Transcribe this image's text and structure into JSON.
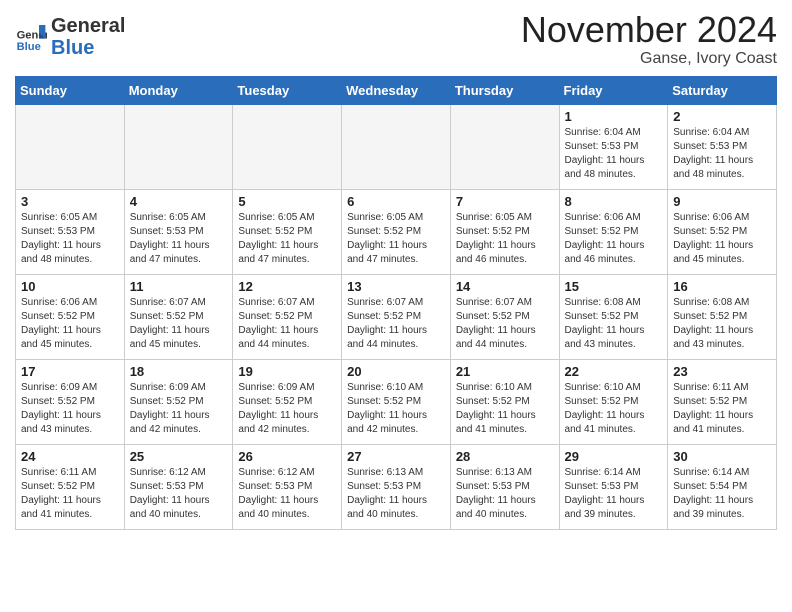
{
  "header": {
    "logo_line1": "General",
    "logo_line2": "Blue",
    "month": "November 2024",
    "location": "Ganse, Ivory Coast"
  },
  "days_of_week": [
    "Sunday",
    "Monday",
    "Tuesday",
    "Wednesday",
    "Thursday",
    "Friday",
    "Saturday"
  ],
  "weeks": [
    [
      {
        "day": "",
        "info": ""
      },
      {
        "day": "",
        "info": ""
      },
      {
        "day": "",
        "info": ""
      },
      {
        "day": "",
        "info": ""
      },
      {
        "day": "",
        "info": ""
      },
      {
        "day": "1",
        "info": "Sunrise: 6:04 AM\nSunset: 5:53 PM\nDaylight: 11 hours\nand 48 minutes."
      },
      {
        "day": "2",
        "info": "Sunrise: 6:04 AM\nSunset: 5:53 PM\nDaylight: 11 hours\nand 48 minutes."
      }
    ],
    [
      {
        "day": "3",
        "info": "Sunrise: 6:05 AM\nSunset: 5:53 PM\nDaylight: 11 hours\nand 48 minutes."
      },
      {
        "day": "4",
        "info": "Sunrise: 6:05 AM\nSunset: 5:53 PM\nDaylight: 11 hours\nand 47 minutes."
      },
      {
        "day": "5",
        "info": "Sunrise: 6:05 AM\nSunset: 5:52 PM\nDaylight: 11 hours\nand 47 minutes."
      },
      {
        "day": "6",
        "info": "Sunrise: 6:05 AM\nSunset: 5:52 PM\nDaylight: 11 hours\nand 47 minutes."
      },
      {
        "day": "7",
        "info": "Sunrise: 6:05 AM\nSunset: 5:52 PM\nDaylight: 11 hours\nand 46 minutes."
      },
      {
        "day": "8",
        "info": "Sunrise: 6:06 AM\nSunset: 5:52 PM\nDaylight: 11 hours\nand 46 minutes."
      },
      {
        "day": "9",
        "info": "Sunrise: 6:06 AM\nSunset: 5:52 PM\nDaylight: 11 hours\nand 45 minutes."
      }
    ],
    [
      {
        "day": "10",
        "info": "Sunrise: 6:06 AM\nSunset: 5:52 PM\nDaylight: 11 hours\nand 45 minutes."
      },
      {
        "day": "11",
        "info": "Sunrise: 6:07 AM\nSunset: 5:52 PM\nDaylight: 11 hours\nand 45 minutes."
      },
      {
        "day": "12",
        "info": "Sunrise: 6:07 AM\nSunset: 5:52 PM\nDaylight: 11 hours\nand 44 minutes."
      },
      {
        "day": "13",
        "info": "Sunrise: 6:07 AM\nSunset: 5:52 PM\nDaylight: 11 hours\nand 44 minutes."
      },
      {
        "day": "14",
        "info": "Sunrise: 6:07 AM\nSunset: 5:52 PM\nDaylight: 11 hours\nand 44 minutes."
      },
      {
        "day": "15",
        "info": "Sunrise: 6:08 AM\nSunset: 5:52 PM\nDaylight: 11 hours\nand 43 minutes."
      },
      {
        "day": "16",
        "info": "Sunrise: 6:08 AM\nSunset: 5:52 PM\nDaylight: 11 hours\nand 43 minutes."
      }
    ],
    [
      {
        "day": "17",
        "info": "Sunrise: 6:09 AM\nSunset: 5:52 PM\nDaylight: 11 hours\nand 43 minutes."
      },
      {
        "day": "18",
        "info": "Sunrise: 6:09 AM\nSunset: 5:52 PM\nDaylight: 11 hours\nand 42 minutes."
      },
      {
        "day": "19",
        "info": "Sunrise: 6:09 AM\nSunset: 5:52 PM\nDaylight: 11 hours\nand 42 minutes."
      },
      {
        "day": "20",
        "info": "Sunrise: 6:10 AM\nSunset: 5:52 PM\nDaylight: 11 hours\nand 42 minutes."
      },
      {
        "day": "21",
        "info": "Sunrise: 6:10 AM\nSunset: 5:52 PM\nDaylight: 11 hours\nand 41 minutes."
      },
      {
        "day": "22",
        "info": "Sunrise: 6:10 AM\nSunset: 5:52 PM\nDaylight: 11 hours\nand 41 minutes."
      },
      {
        "day": "23",
        "info": "Sunrise: 6:11 AM\nSunset: 5:52 PM\nDaylight: 11 hours\nand 41 minutes."
      }
    ],
    [
      {
        "day": "24",
        "info": "Sunrise: 6:11 AM\nSunset: 5:52 PM\nDaylight: 11 hours\nand 41 minutes."
      },
      {
        "day": "25",
        "info": "Sunrise: 6:12 AM\nSunset: 5:53 PM\nDaylight: 11 hours\nand 40 minutes."
      },
      {
        "day": "26",
        "info": "Sunrise: 6:12 AM\nSunset: 5:53 PM\nDaylight: 11 hours\nand 40 minutes."
      },
      {
        "day": "27",
        "info": "Sunrise: 6:13 AM\nSunset: 5:53 PM\nDaylight: 11 hours\nand 40 minutes."
      },
      {
        "day": "28",
        "info": "Sunrise: 6:13 AM\nSunset: 5:53 PM\nDaylight: 11 hours\nand 40 minutes."
      },
      {
        "day": "29",
        "info": "Sunrise: 6:14 AM\nSunset: 5:53 PM\nDaylight: 11 hours\nand 39 minutes."
      },
      {
        "day": "30",
        "info": "Sunrise: 6:14 AM\nSunset: 5:54 PM\nDaylight: 11 hours\nand 39 minutes."
      }
    ]
  ]
}
